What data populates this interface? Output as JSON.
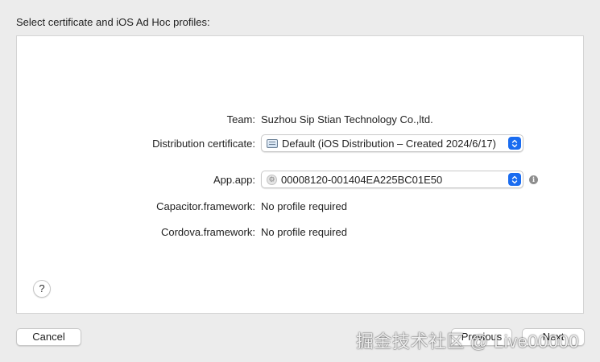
{
  "dialog": {
    "prompt": "Select certificate and iOS Ad Hoc profiles:"
  },
  "form": {
    "team": {
      "label": "Team:",
      "value": "Suzhou Sip Stian Technology Co.,ltd."
    },
    "distribution_certificate": {
      "label": "Distribution certificate:",
      "value": "Default (iOS Distribution – Created 2024/6/17)"
    },
    "app": {
      "label": "App.app:",
      "value": "00008120-001404EA225BC01E50"
    },
    "capacitor": {
      "label": "Capacitor.framework:",
      "value": "No profile required"
    },
    "cordova": {
      "label": "Cordova.framework:",
      "value": "No profile required"
    }
  },
  "help": {
    "label": "?"
  },
  "buttons": {
    "cancel": "Cancel",
    "previous": "Previous",
    "next": "Next"
  },
  "watermark": "掘金技术社区 @ Live00000",
  "colors": {
    "accent": "#1a6cf0",
    "panel": "#ffffff",
    "window": "#ececec"
  }
}
